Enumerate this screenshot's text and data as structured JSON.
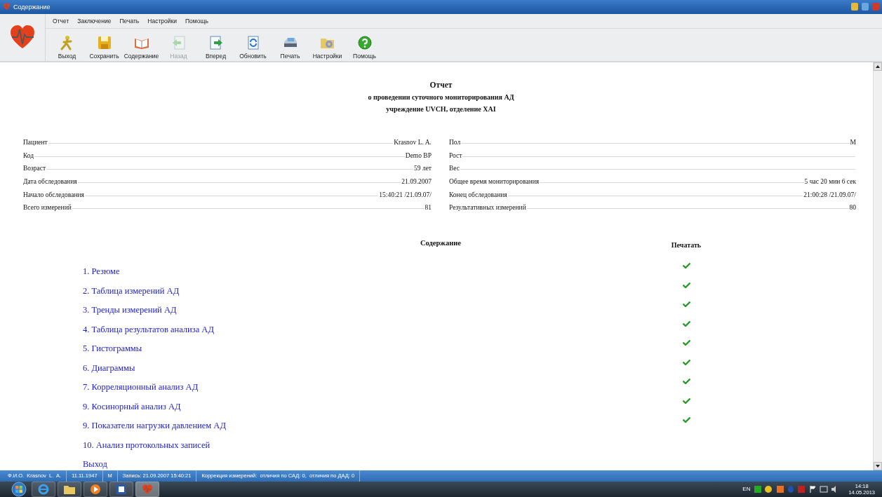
{
  "window": {
    "title": "Содержание"
  },
  "menu": [
    "Отчет",
    "Заключение",
    "Печать",
    "Настройки",
    "Помощь"
  ],
  "toolbar": [
    {
      "label": "Выход",
      "disabled": false
    },
    {
      "label": "Сохранить",
      "disabled": false
    },
    {
      "label": "Содержание",
      "disabled": false
    },
    {
      "label": "Назад",
      "disabled": true
    },
    {
      "label": "Вперед",
      "disabled": false
    },
    {
      "label": "Обновить",
      "disabled": false
    },
    {
      "label": "Печать",
      "disabled": false
    },
    {
      "label": "Настройки",
      "disabled": false
    },
    {
      "label": "Помощь",
      "disabled": false
    }
  ],
  "report": {
    "title": "Отчет",
    "subtitle": "о проведении суточного мониторирования АД",
    "institution": "учреждение UVCH, отделение XAI"
  },
  "info_left": [
    {
      "label": "Пациент",
      "value": "Krasnov L. A."
    },
    {
      "label": "Код",
      "value": "Demo BP"
    },
    {
      "label": "Возраст",
      "value": "59 лет"
    },
    {
      "label": "Дата обследования",
      "value": "21.09.2007"
    },
    {
      "label": "Начало обследования",
      "value": "15:40:21  /21.09.07/"
    },
    {
      "label": "Всего измерений",
      "value": "81"
    }
  ],
  "info_right": [
    {
      "label": "Пол",
      "value": "М"
    },
    {
      "label": "Рост"
    },
    {
      "label": "Вес"
    },
    {
      "label": "Общее время мониторирования",
      "value": "5 час 20 мин 6 сек"
    },
    {
      "label": "Конец обследования",
      "value": "21:00:28  /21.09.07/"
    },
    {
      "label": "Результативных измерений",
      "value": "80"
    }
  ],
  "contents": {
    "heading": "Содержание",
    "print_heading": "Печатать",
    "items": [
      {
        "label": "1. Резюме",
        "print": true
      },
      {
        "label": "2. Таблица измерений АД",
        "print": true
      },
      {
        "label": "3. Тренды измерений АД",
        "print": true
      },
      {
        "label": "4. Таблица результатов анализа АД",
        "print": true
      },
      {
        "label": "5. Гистограммы",
        "print": true
      },
      {
        "label": "6. Диаграммы",
        "print": true
      },
      {
        "label": "7. Корреляционный анализ АД",
        "print": true
      },
      {
        "label": "9. Косинорный анализ АД",
        "print": true
      },
      {
        "label": "9. Показатели нагрузки давлением АД",
        "print": true
      },
      {
        "label": "10. Анализ протокольных записей",
        "print": false
      },
      {
        "label": "Выход",
        "print": false
      }
    ]
  },
  "status_bar": [
    "Ф.И.О.  Krasnov  L.  A.",
    "11.11.1947",
    "М",
    "Запись: 21.09.2007 15:40:21",
    "Коррекция измерений:  отличия по САД: 0,  отличия по ДАД: 0"
  ],
  "taskbar": {
    "language": "EN",
    "time": "14:18",
    "date": "14.05.2013"
  }
}
